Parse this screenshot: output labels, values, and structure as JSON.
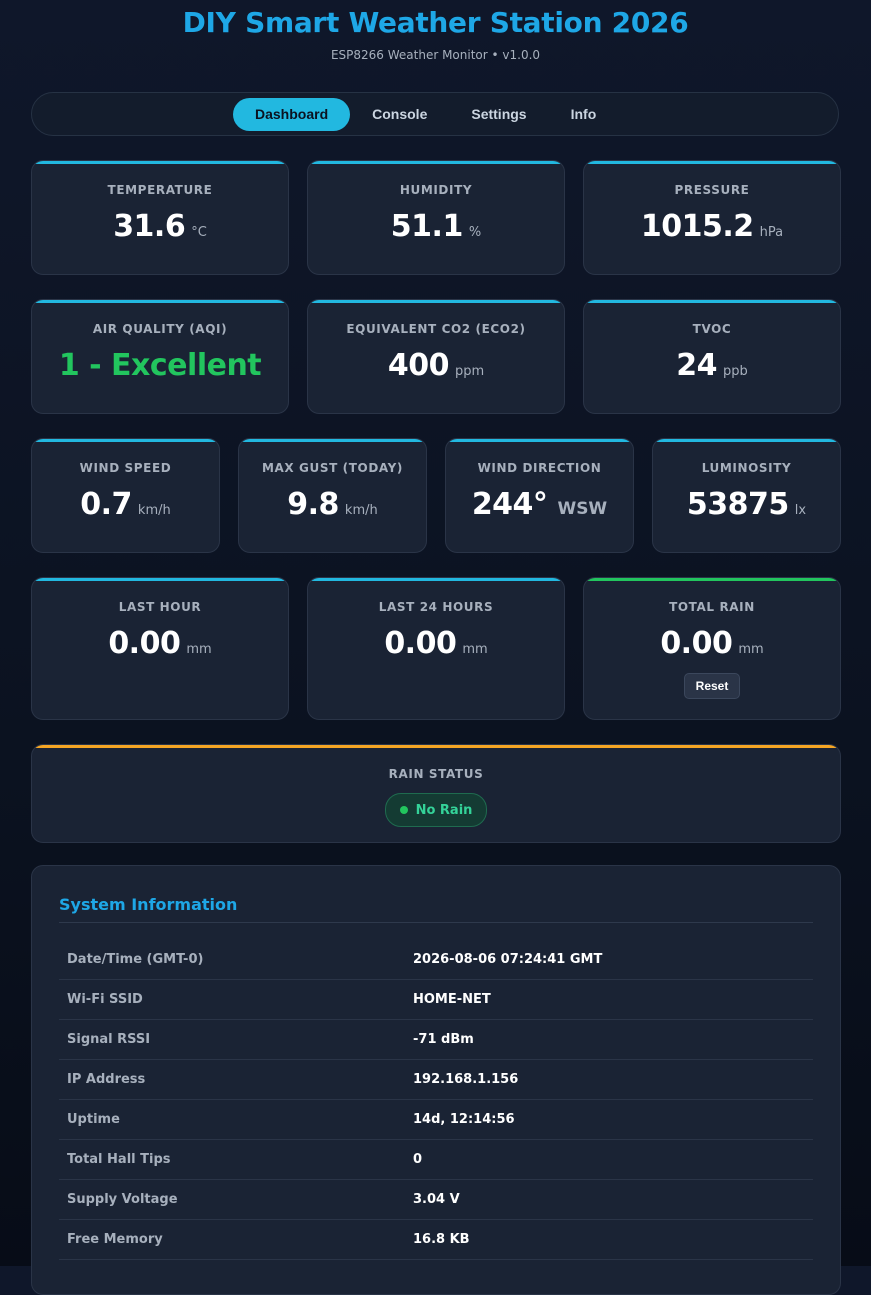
{
  "header": {
    "title": "DIY Smart Weather Station 2026",
    "subtitle": "ESP8266 Weather Monitor • v1.0.0"
  },
  "nav": {
    "tabs": [
      {
        "label": "Dashboard",
        "active": true
      },
      {
        "label": "Console",
        "active": false
      },
      {
        "label": "Settings",
        "active": false
      },
      {
        "label": "Info",
        "active": false
      }
    ]
  },
  "cards": {
    "temperature": {
      "label": "TEMPERATURE",
      "value": "31.6",
      "unit": "°C"
    },
    "humidity": {
      "label": "HUMIDITY",
      "value": "51.1",
      "unit": "%"
    },
    "pressure": {
      "label": "PRESSURE",
      "value": "1015.2",
      "unit": "hPa"
    },
    "aqi": {
      "label": "AIR QUALITY (AQI)",
      "value": "1 - Excellent",
      "color": "#22c55e"
    },
    "eco2": {
      "label": "EQUIVALENT CO2 (ECO2)",
      "value": "400",
      "unit": "ppm"
    },
    "tvoc": {
      "label": "TVOC",
      "value": "24",
      "unit": "ppb"
    },
    "wind_speed": {
      "label": "WIND SPEED",
      "value": "0.7",
      "unit": "km/h"
    },
    "max_gust": {
      "label": "MAX GUST (TODAY)",
      "value": "9.8",
      "unit": "km/h"
    },
    "wind_direction": {
      "label": "WIND DIRECTION",
      "value": "244°",
      "unit": "WSW"
    },
    "luminosity": {
      "label": "LUMINOSITY",
      "value": "53875",
      "unit": "lx"
    },
    "last_hour": {
      "label": "LAST HOUR",
      "value": "0.00",
      "unit": "mm"
    },
    "last_24h": {
      "label": "LAST 24 HOURS",
      "value": "0.00",
      "unit": "mm"
    },
    "total_rain": {
      "label": "TOTAL RAIN",
      "value": "0.00",
      "unit": "mm",
      "reset_label": "Reset"
    }
  },
  "rain_status": {
    "label": "RAIN STATUS",
    "status": "No Rain",
    "color": "#22c55e"
  },
  "system": {
    "title": "System Information",
    "rows": [
      {
        "key": "Date/Time (GMT-0)",
        "value": "2026-08-06 07:24:41 GMT"
      },
      {
        "key": "Wi-Fi SSID",
        "value": "HOME-NET"
      },
      {
        "key": "Signal RSSI",
        "value": "-71 dBm"
      },
      {
        "key": "IP Address",
        "value": "192.168.1.156"
      },
      {
        "key": "Uptime",
        "value": "14d, 12:14:56"
      },
      {
        "key": "Total Hall Tips",
        "value": "0"
      },
      {
        "key": "Supply Voltage",
        "value": "3.04 V"
      },
      {
        "key": "Free Memory",
        "value": "16.8 KB"
      }
    ]
  },
  "colors": {
    "accent": "#22b8e0",
    "title": "#1ea7e6",
    "success": "#22c55e",
    "warning": "#f5a524",
    "card_bg": "#1a2334"
  }
}
